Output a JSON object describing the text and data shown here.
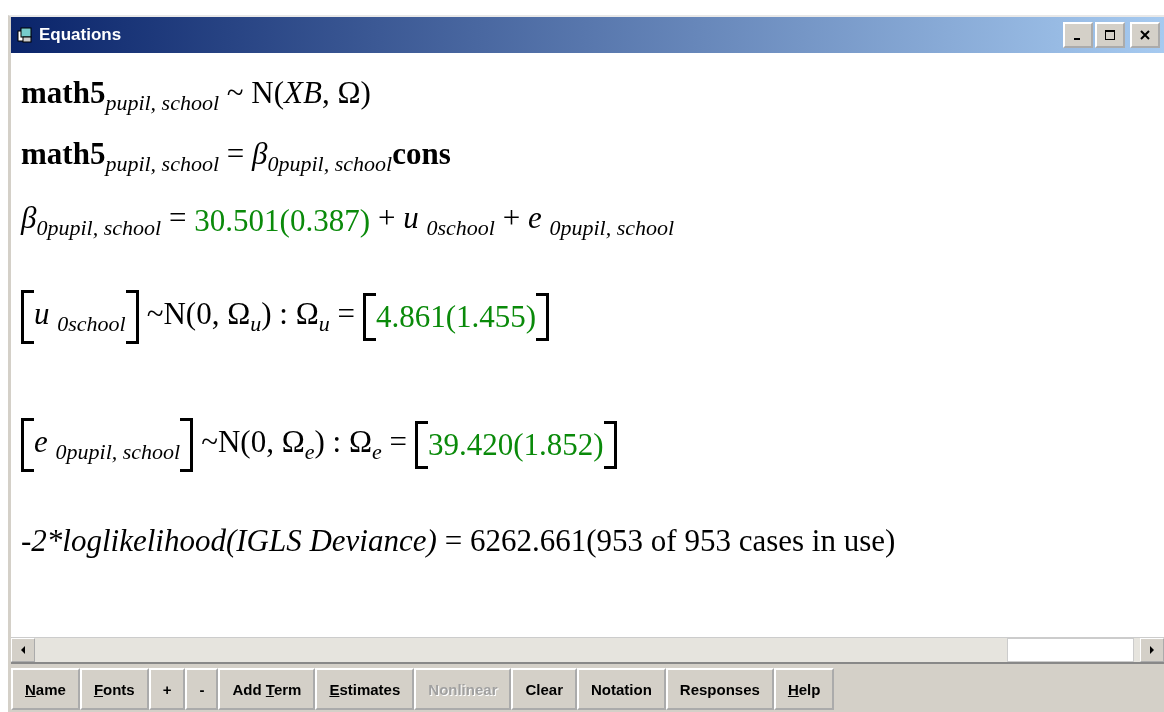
{
  "window": {
    "title": "Equations"
  },
  "equations": [
    {
      "kind": "line",
      "segments": [
        {
          "kind": "plain",
          "text": "**math5**$_{pupil, school}$ ~ N(*XB*, Ω)"
        }
      ]
    },
    {
      "kind": "line",
      "segments": [
        {
          "kind": "plain",
          "text": "**math5**$_{pupil, school}$ = *β*$_{0pupil, school}$**cons**"
        }
      ]
    },
    {
      "kind": "line",
      "segments": [
        {
          "kind": "plain",
          "text": "*β*$_{0pupil, school}$ ="
        },
        {
          "kind": "estimate",
          "text": "30.501(0.387)"
        },
        {
          "kind": "plain",
          "text": "+ *u* $_{0school}$ + *e* $_{0pupil, school}$"
        }
      ]
    },
    {
      "kind": "matrix",
      "segments": [
        {
          "kind": "bracket",
          "text": "*u* $_{0school}$"
        },
        {
          "kind": "plain",
          "text": "~N(0,  Ω$_{u}$)  :  Ω$_{u}$ ="
        },
        {
          "kind": "bracket_estimate",
          "text": "4.861(1.455)"
        }
      ]
    },
    {
      "kind": "matrix",
      "segments": [
        {
          "kind": "bracket",
          "text": "*e* $_{0pupil, school}$"
        },
        {
          "kind": "plain",
          "text": "~N(0,  Ω$_{e}$)  :  Ω$_{e}$ ="
        },
        {
          "kind": "bracket_estimate",
          "text": "39.420(1.852)"
        }
      ]
    },
    {
      "kind": "line",
      "segments": [
        {
          "kind": "italic",
          "text": "-2*loglikelihood(IGLS Deviance)"
        },
        {
          "kind": "plain",
          "text": "= 6262.661(953 of 953 cases in use)"
        }
      ]
    }
  ],
  "buttons": [
    {
      "key": "N",
      "after": "ame",
      "disabled": false
    },
    {
      "key": "F",
      "after": "onts",
      "disabled": false
    },
    {
      "before": "+",
      "disabled": false
    },
    {
      "before": "-",
      "disabled": false
    },
    {
      "before": "Add ",
      "key": "T",
      "after": "erm",
      "disabled": false
    },
    {
      "key": "E",
      "after": "stimates",
      "disabled": false
    },
    {
      "before": "Nonlinear",
      "disabled": true
    },
    {
      "before": "Clear",
      "disabled": false
    },
    {
      "before": "Notation",
      "disabled": false
    },
    {
      "before": "Responses",
      "disabled": false
    },
    {
      "key": "H",
      "after": "elp",
      "disabled": false
    }
  ]
}
